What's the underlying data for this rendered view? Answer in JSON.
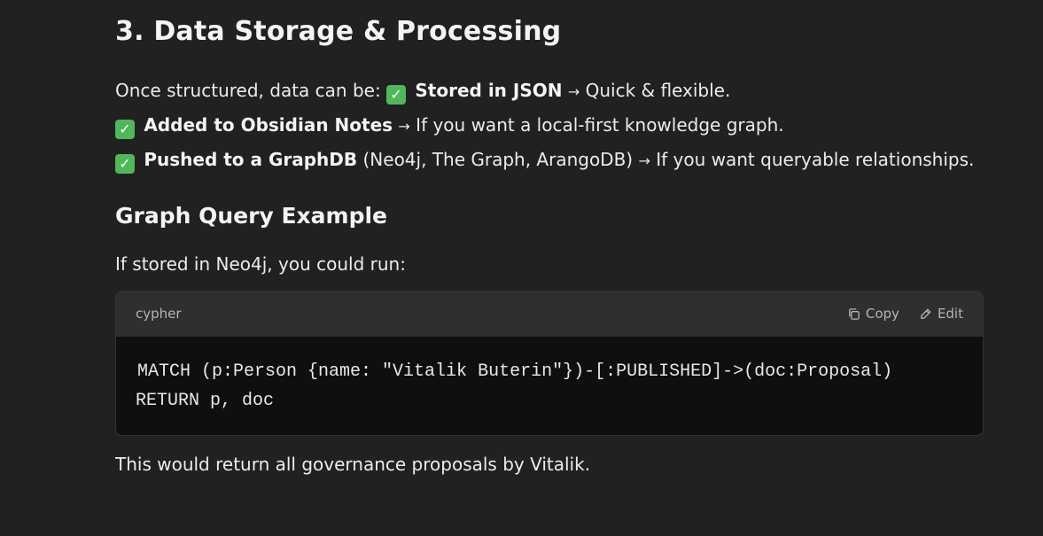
{
  "section": {
    "title": "3. Data Storage & Processing",
    "intro_prefix": "Once structured, data can be: ",
    "items": [
      {
        "bold": "Stored in JSON",
        "arrow": "→",
        "text": "Quick & flexible."
      },
      {
        "bold": "Added to Obsidian Notes",
        "arrow": "→",
        "text": "If you want a local-first knowledge graph."
      },
      {
        "bold": "Pushed to a GraphDB",
        "extra": "(Neo4j, The Graph, ArangoDB)",
        "arrow": "→",
        "text": "If you want queryable relationships."
      }
    ],
    "check_icon": "✓"
  },
  "example": {
    "title": "Graph Query Example",
    "lead": "If stored in Neo4j, you could run:",
    "code_block": {
      "language": "cypher",
      "copy_label": "Copy",
      "edit_label": "Edit",
      "lines": [
        "MATCH (p:Person {name: \"Vitalik Buterin\"})-[:PUBLISHED]->(doc:Proposal)",
        "RETURN p, doc"
      ]
    },
    "after": "This would return all governance proposals by Vitalik."
  },
  "colors": {
    "background": "#212121",
    "code_header": "#2f2f2f",
    "code_body": "#0f0f0f",
    "check": "#4fb85a"
  }
}
